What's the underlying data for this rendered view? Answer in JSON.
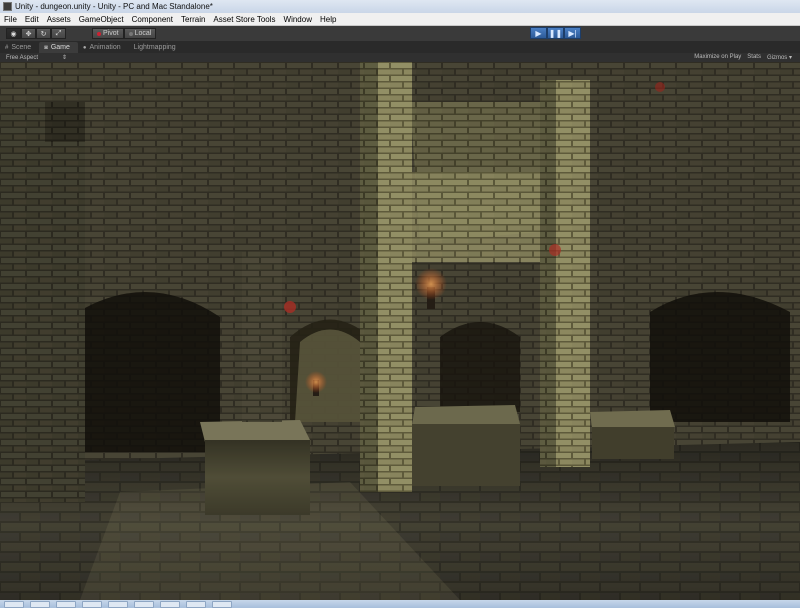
{
  "window": {
    "title": "Unity - dungeon.unity - Unity - PC and Mac Standalone*"
  },
  "menu": [
    "File",
    "Edit",
    "Assets",
    "GameObject",
    "Component",
    "Terrain",
    "Asset Store Tools",
    "Window",
    "Help"
  ],
  "toolbar": {
    "tools": [
      "hand-icon",
      "move-icon",
      "rotate-icon",
      "scale-icon"
    ],
    "pivot_label": "Pivot",
    "local_label": "Local",
    "play_icons": [
      "play-icon",
      "pause-icon",
      "step-icon"
    ]
  },
  "tabs": [
    {
      "label": "Scene",
      "icon": "hash-icon"
    },
    {
      "label": "Game",
      "icon": "gamepad-icon"
    },
    {
      "label": "Animation",
      "icon": "animation-icon"
    },
    {
      "label": "Lightmapping",
      "icon": ""
    }
  ],
  "game_view": {
    "aspect_label": "Free Aspect",
    "aspect_arrow": "⇕",
    "maximize_label": "Maximize on Play",
    "stats_label": "Stats",
    "gizmos_label": "Gizmos",
    "gizmos_arrow": "▾"
  },
  "colors": {
    "play_accent": "#3a6fb5",
    "torch": "#d9682a"
  }
}
